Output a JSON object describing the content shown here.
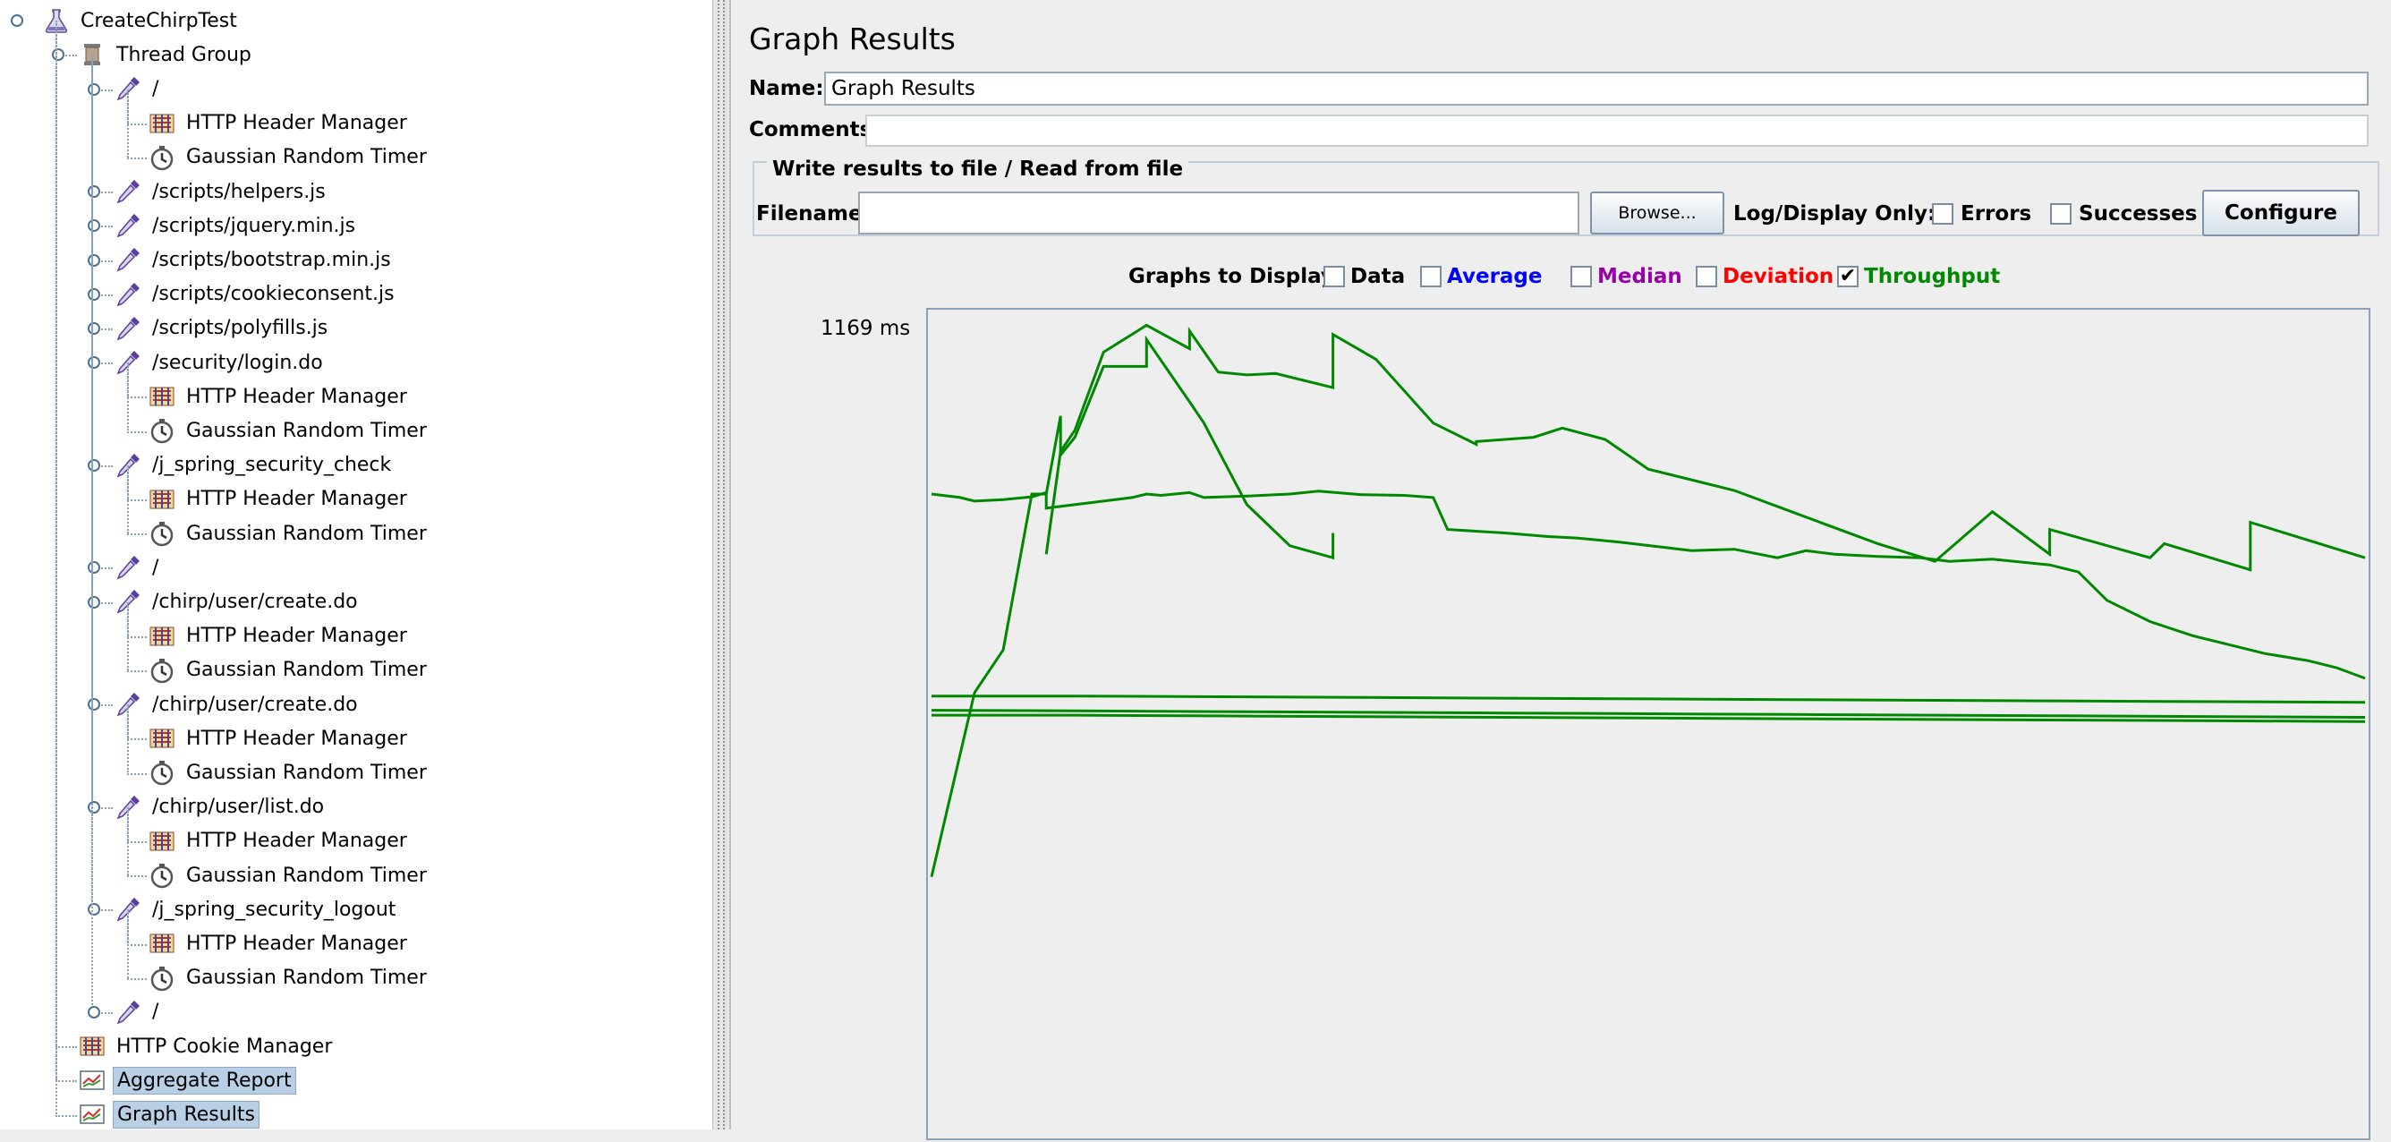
{
  "tree": {
    "items": [
      {
        "label": "CreateChirpTest",
        "level": 0,
        "icon": "flask-icon",
        "expanded": true
      },
      {
        "label": "Thread Group",
        "level": 1,
        "icon": "spool-icon",
        "expanded": true
      },
      {
        "label": "/",
        "level": 2,
        "icon": "pipette-icon",
        "expanded": true
      },
      {
        "label": "HTTP Header Manager",
        "level": 3,
        "icon": "header-manager-icon"
      },
      {
        "label": "Gaussian Random Timer",
        "level": 3,
        "icon": "stopwatch-icon"
      },
      {
        "label": "/scripts/helpers.js",
        "level": 2,
        "icon": "pipette-icon",
        "expanded": false
      },
      {
        "label": "/scripts/jquery.min.js",
        "level": 2,
        "icon": "pipette-icon",
        "expanded": false
      },
      {
        "label": "/scripts/bootstrap.min.js",
        "level": 2,
        "icon": "pipette-icon",
        "expanded": false
      },
      {
        "label": "/scripts/cookieconsent.js",
        "level": 2,
        "icon": "pipette-icon",
        "expanded": false
      },
      {
        "label": "/scripts/polyfills.js",
        "level": 2,
        "icon": "pipette-icon",
        "expanded": false
      },
      {
        "label": "/security/login.do",
        "level": 2,
        "icon": "pipette-icon",
        "expanded": true
      },
      {
        "label": "HTTP Header Manager",
        "level": 3,
        "icon": "header-manager-icon"
      },
      {
        "label": "Gaussian Random Timer",
        "level": 3,
        "icon": "stopwatch-icon"
      },
      {
        "label": "/j_spring_security_check",
        "level": 2,
        "icon": "pipette-icon",
        "expanded": true
      },
      {
        "label": "HTTP Header Manager",
        "level": 3,
        "icon": "header-manager-icon"
      },
      {
        "label": "Gaussian Random Timer",
        "level": 3,
        "icon": "stopwatch-icon"
      },
      {
        "label": "/",
        "level": 2,
        "icon": "pipette-icon",
        "expanded": false
      },
      {
        "label": "/chirp/user/create.do",
        "level": 2,
        "icon": "pipette-icon",
        "expanded": true
      },
      {
        "label": "HTTP Header Manager",
        "level": 3,
        "icon": "header-manager-icon"
      },
      {
        "label": "Gaussian Random Timer",
        "level": 3,
        "icon": "stopwatch-icon"
      },
      {
        "label": "/chirp/user/create.do",
        "level": 2,
        "icon": "pipette-icon",
        "expanded": true
      },
      {
        "label": "HTTP Header Manager",
        "level": 3,
        "icon": "header-manager-icon"
      },
      {
        "label": "Gaussian Random Timer",
        "level": 3,
        "icon": "stopwatch-icon"
      },
      {
        "label": "/chirp/user/list.do",
        "level": 2,
        "icon": "pipette-icon",
        "expanded": true
      },
      {
        "label": "HTTP Header Manager",
        "level": 3,
        "icon": "header-manager-icon"
      },
      {
        "label": "Gaussian Random Timer",
        "level": 3,
        "icon": "stopwatch-icon"
      },
      {
        "label": "/j_spring_security_logout",
        "level": 2,
        "icon": "pipette-icon",
        "expanded": true
      },
      {
        "label": "HTTP Header Manager",
        "level": 3,
        "icon": "header-manager-icon"
      },
      {
        "label": "Gaussian Random Timer",
        "level": 3,
        "icon": "stopwatch-icon"
      },
      {
        "label": "/",
        "level": 2,
        "icon": "pipette-icon",
        "expanded": false
      },
      {
        "label": "HTTP Cookie Manager",
        "level": 1,
        "icon": "cookie-manager-icon"
      },
      {
        "label": "Aggregate Report",
        "level": 1,
        "icon": "report-icon",
        "selected": true
      },
      {
        "label": "Graph Results",
        "level": 1,
        "icon": "report-icon",
        "selected": true
      }
    ]
  },
  "panel": {
    "title": "Graph Results",
    "name_label": "Name:",
    "name_value": "Graph Results",
    "comments_label": "Comments:",
    "comments_value": "",
    "file_group_title": "Write results to file / Read from file",
    "filename_label": "Filename",
    "filename_value": "",
    "browse_label": "Browse...",
    "log_display_label": "Log/Display Only:",
    "errors_label": "Errors",
    "errors_checked": false,
    "successes_label": "Successes",
    "successes_checked": false,
    "configure_label": "Configure"
  },
  "graphs": {
    "label": "Graphs to Display",
    "options": [
      {
        "label": "Data",
        "checked": false,
        "color": "#000000"
      },
      {
        "label": "Average",
        "checked": false,
        "color": "#0000ff"
      },
      {
        "label": "Median",
        "checked": false,
        "color": "#9900aa"
      },
      {
        "label": "Deviation",
        "checked": false,
        "color": "#ff0000"
      },
      {
        "label": "Throughput",
        "checked": true,
        "color": "#008800"
      }
    ]
  },
  "chart_data": {
    "type": "line",
    "ymax_label": "1169 ms",
    "ylim": [
      0,
      1169
    ],
    "line_color": "#008800",
    "series": [
      {
        "x": [
          0,
          3,
          5,
          7,
          8,
          9,
          9,
          10,
          12,
          15,
          15,
          18,
          19,
          22,
          25,
          28,
          28
        ],
        "values": [
          -800,
          -540,
          -480,
          -260,
          -260,
          -150,
          -205,
          -180,
          -80,
          80,
          42,
          130,
          160,
          275,
          333,
          350,
          315
        ]
      },
      {
        "x": [
          8,
          9,
          10,
          12,
          15,
          18,
          18,
          20,
          22,
          24,
          28,
          28,
          31,
          35,
          38,
          38,
          42,
          44,
          47,
          50,
          56,
          60,
          66,
          70,
          74,
          78,
          78,
          85,
          86,
          92,
          92,
          100
        ],
        "values": [
          -345,
          -200,
          -170,
          -60,
          22,
          55,
          30,
          88,
          92,
          90,
          110,
          35,
          70,
          160,
          190,
          186,
          180,
          167,
          183,
          225,
          255,
          285,
          330,
          355,
          285,
          345,
          310,
          350,
          330,
          367,
          300,
          350
        ]
      },
      {
        "x": [
          0,
          2,
          3,
          5,
          7,
          8,
          8,
          12,
          14,
          15,
          16,
          18,
          19,
          22,
          25,
          27,
          30,
          33,
          35,
          36,
          40,
          43,
          45,
          48,
          51,
          53,
          56,
          59,
          61,
          63,
          66,
          69,
          71,
          74,
          78,
          80,
          82,
          85,
          88,
          90,
          93,
          96,
          98,
          100
        ],
        "values": [
          -260,
          -265,
          -270,
          -268,
          -264,
          -258,
          -280,
          -270,
          -265,
          -260,
          -262,
          -258,
          -265,
          -263,
          -260,
          -256,
          -261,
          -262,
          -265,
          -310,
          -315,
          -320,
          -322,
          -328,
          -335,
          -340,
          -338,
          -350,
          -340,
          -345,
          -348,
          -350,
          -355,
          -352,
          -360,
          -370,
          -410,
          -440,
          -460,
          -470,
          -485,
          -495,
          -505,
          -520
        ]
      },
      {
        "x": [
          0,
          10,
          20,
          30,
          40,
          50,
          60,
          70,
          80,
          90,
          100
        ],
        "values": [
          -545,
          -545,
          -546,
          -547,
          -548,
          -549,
          -550,
          -551,
          -552,
          -553,
          -554
        ]
      },
      {
        "x": [
          0,
          10,
          20,
          30,
          40,
          50,
          60,
          70,
          80,
          90,
          100
        ],
        "values": [
          -565,
          -566,
          -567,
          -568,
          -569,
          -570,
          -571,
          -572,
          -573,
          -574,
          -575
        ]
      },
      {
        "x": [
          0,
          10,
          20,
          30,
          40,
          50,
          60,
          70,
          80,
          90,
          100
        ],
        "values": [
          -572,
          -572,
          -573,
          -574,
          -575,
          -576,
          -577,
          -578,
          -579,
          -580,
          -581
        ]
      }
    ]
  }
}
